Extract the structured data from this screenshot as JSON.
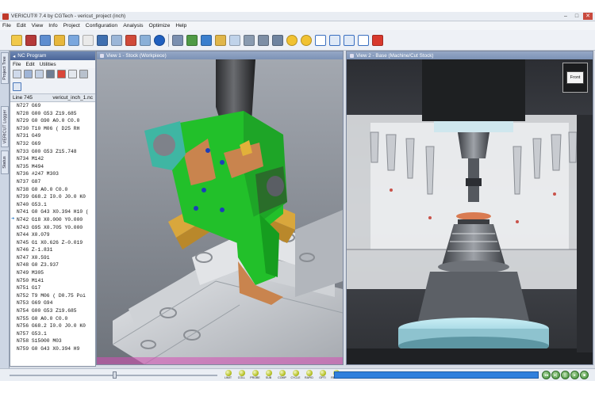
{
  "window": {
    "title": "VERICUT® 7.4 by CGTech - vericut_project (inch)"
  },
  "menu": [
    "File",
    "Edit",
    "View",
    "Info",
    "Project",
    "Configuration",
    "Analysis",
    "Optimize",
    "Help"
  ],
  "left_tabs": [
    "Project Tree",
    "VERICUT Logger",
    "Status"
  ],
  "nc_program": {
    "title": "NC Program",
    "menu": [
      "File",
      "Edit",
      "Utilities"
    ],
    "line_label": "Line 745",
    "file_label": "vericut_inch_1.nc",
    "current_index": 15,
    "lines": [
      "N727 G69",
      "N728 G00 G53 Z19.685",
      "N729 G0 G90 A0.0 C0.0",
      "N730 T10 M06  ( D25 RH",
      "N731 G49",
      "N732 G69",
      "N733 G00 G53 Z15.748",
      "N734 M142",
      "N735 M494",
      "N736 #247 M303",
      "N737 G87",
      "N738 G0 A0.0 C0.0",
      "N739 G68.2 I0.0 J0.0 K0",
      "N740 G53.1",
      "N741 G0 G43 X0.394 H10 (",
      "N742 G18 X0.000 Y0.000",
      "N743 G95 X0.705 Y0.000",
      "N744 X0.079",
      "N745 G1 X0.626 Z-0.019",
      "N746 Z-1.831",
      "N747 X0.591",
      "N748 G0 Z3.937",
      "N749 M305",
      "N750 M141",
      "N751 G17",
      "N752 T9 M06  ( D0.75 Poi",
      "N753 G69 G94",
      "N754 G00 G53 Z19.685",
      "N755 G0 A0.0 C0.0",
      "N756 G68.2 I0.0 J0.0 K0",
      "N757 G53.1",
      "N758 S15000 M03",
      "N759 G0 G43 X0.394 H9"
    ]
  },
  "view1": {
    "title": "View 1 - Stock (Workpiece)"
  },
  "view2": {
    "title": "View 2 - Base (Machine/Cut Stock)",
    "cube_label": "Front"
  },
  "status_lights": [
    "LIMIT",
    "COLL",
    "PROBE",
    "SUB",
    "COMP",
    "CYCLE",
    "RAPID",
    "OPTI",
    "READY"
  ],
  "colors": {
    "part_green": "#22c02a",
    "part_orange": "#c9844e",
    "part_teal": "#3fb6a3",
    "fixture_gold": "#d9a73c",
    "progress_blue": "#2f7fdc"
  }
}
